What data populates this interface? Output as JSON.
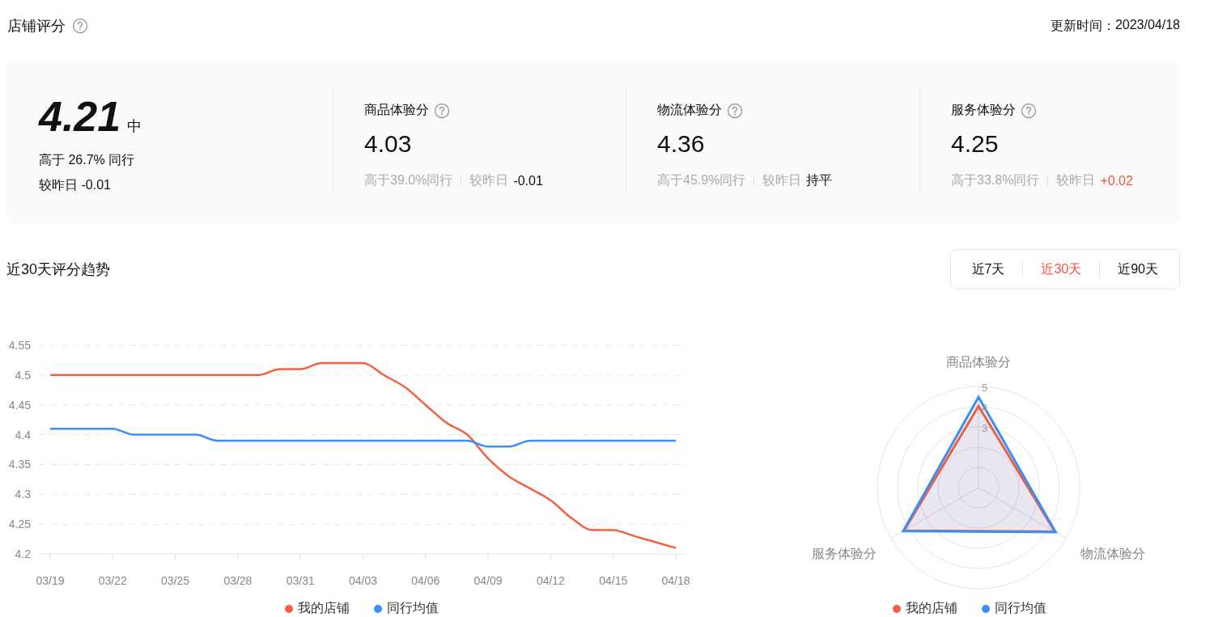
{
  "header": {
    "title": "店铺评分",
    "update_label": "更新时间：",
    "update_date": "2023/04/18"
  },
  "overall": {
    "score": "4.21",
    "grade": "中",
    "rank_text": "高于 26.7% 同行",
    "change_label": "较昨日",
    "change": "-0.01"
  },
  "metrics": [
    {
      "name": "商品体验分",
      "score": "4.03",
      "rank_text": "高于39.0%同行",
      "change_label": "较昨日",
      "change": "-0.01",
      "color": "#111111"
    },
    {
      "name": "物流体验分",
      "score": "4.36",
      "rank_text": "高于45.9%同行",
      "change_label": "较昨日",
      "change": "持平",
      "color": "#111111"
    },
    {
      "name": "服务体验分",
      "score": "4.25",
      "rank_text": "高于33.8%同行",
      "change_label": "较昨日",
      "change": "+0.02",
      "color": "#f5533d"
    }
  ],
  "trend": {
    "title": "近30天评分趋势",
    "ranges": [
      {
        "label": "近7天",
        "selected": false
      },
      {
        "label": "近30天",
        "selected": true
      },
      {
        "label": "近90天",
        "selected": false
      }
    ],
    "chart_data": {
      "type": "line",
      "grid": true,
      "categories": [
        "03/19",
        null,
        null,
        "03/22",
        null,
        null,
        "03/25",
        null,
        null,
        "03/28",
        null,
        null,
        "03/31",
        null,
        null,
        "04/03",
        null,
        null,
        "04/06",
        null,
        null,
        "04/09",
        null,
        null,
        "04/12",
        null,
        null,
        "04/15",
        null,
        null,
        "04/18"
      ],
      "ylim": [
        4.2,
        4.55
      ],
      "yticks": [
        {
          "value": 4.2,
          "label": "4.2"
        },
        {
          "value": 4.25,
          "label": "4.25"
        },
        {
          "value": 4.3,
          "label": "4.3"
        },
        {
          "value": 4.35,
          "label": "4.35"
        },
        {
          "value": 4.4,
          "label": "4.4"
        },
        {
          "value": 4.45,
          "label": "4.45"
        },
        {
          "value": 4.5,
          "label": "4.5"
        },
        {
          "value": 4.55,
          "label": "4.55"
        }
      ],
      "series": [
        {
          "name": "我的店铺",
          "color": "#f5603f",
          "values": [
            4.5,
            4.5,
            4.5,
            4.5,
            4.5,
            4.5,
            4.5,
            4.5,
            4.5,
            4.5,
            4.5,
            4.51,
            4.51,
            4.52,
            4.52,
            4.52,
            4.5,
            4.48,
            4.45,
            4.42,
            4.4,
            4.36,
            4.33,
            4.31,
            4.29,
            4.26,
            4.24,
            4.24,
            4.23,
            4.22,
            4.21
          ]
        },
        {
          "name": "同行均值",
          "color": "#3a8ef6",
          "values": [
            4.41,
            4.41,
            4.41,
            4.41,
            4.4,
            4.4,
            4.4,
            4.4,
            4.39,
            4.39,
            4.39,
            4.39,
            4.39,
            4.39,
            4.39,
            4.39,
            4.39,
            4.39,
            4.39,
            4.39,
            4.39,
            4.38,
            4.38,
            4.39,
            4.39,
            4.39,
            4.39,
            4.39,
            4.39,
            4.39,
            4.39
          ]
        }
      ]
    }
  },
  "radar": {
    "chart_data": {
      "type": "radar",
      "categories": [
        "商品体验分",
        "物流体验分",
        "服务体验分"
      ],
      "ylim": [
        0,
        5
      ],
      "yticks": [
        3,
        4,
        5
      ],
      "series": [
        {
          "name": "我的店铺",
          "color": "#f5603f",
          "values": [
            4.03,
            4.36,
            4.25
          ]
        },
        {
          "name": "同行均值",
          "color": "#3a8ef6",
          "values": [
            4.48,
            4.4,
            4.3
          ]
        }
      ]
    }
  }
}
